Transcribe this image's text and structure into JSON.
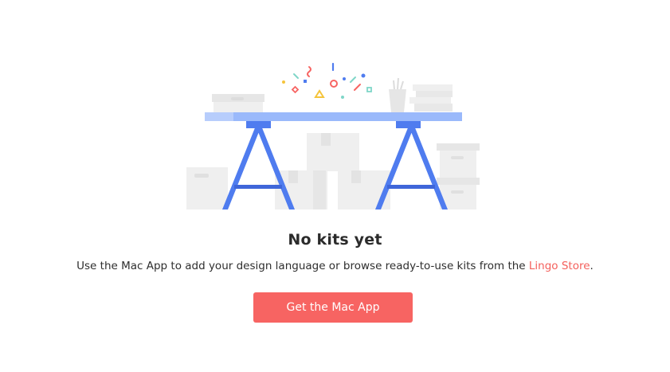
{
  "empty_state": {
    "title": "No kits yet",
    "message_before_link": "Use the Mac App to add your design language or browse ready-to-use kits from the ",
    "link_text": "Lingo Store",
    "message_after_link": ".",
    "button_label": "Get the Mac App"
  },
  "colors": {
    "accent": "#f76462",
    "link": "#f4605c",
    "table_top": "#9ab9fb",
    "table_leg": "#4f7cef",
    "box": "#efefef",
    "box_shade": "#e3e3e3"
  }
}
